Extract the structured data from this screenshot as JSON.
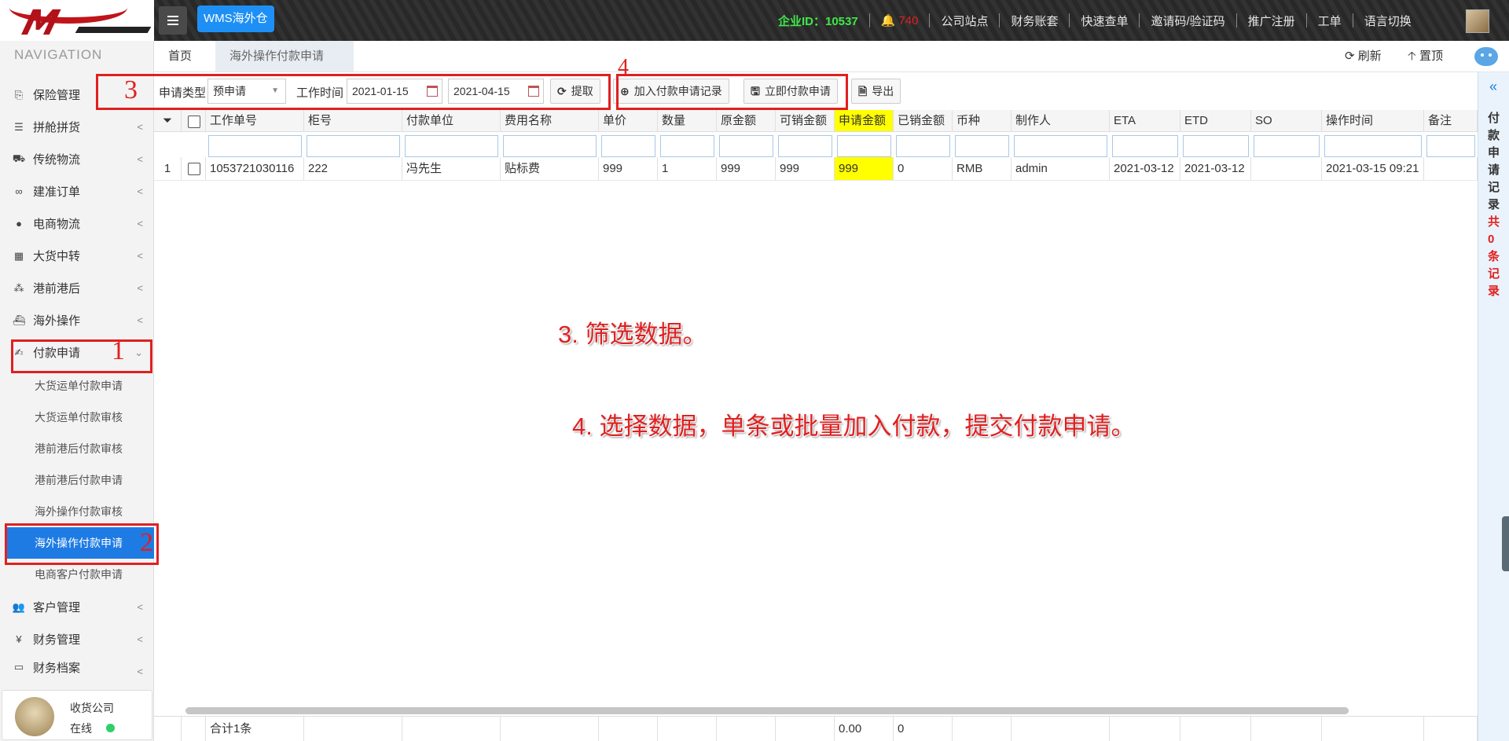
{
  "topbar": {
    "wms_badge": "WMS海外仓",
    "enterprise_id": "企业ID：10537",
    "notifications": "740",
    "links": [
      "公司站点",
      "财务账套",
      "快速查单",
      "邀请码/验证码",
      "推广注册",
      "工单",
      "语言切换"
    ]
  },
  "sidebar": {
    "title": "NAVIGATION",
    "items": [
      {
        "label": "保险管理",
        "icon": "shield-icon"
      },
      {
        "label": "拼舱拼货",
        "icon": "list-icon"
      },
      {
        "label": "传统物流",
        "icon": "truck-icon"
      },
      {
        "label": "建准订单",
        "icon": "link-icon"
      },
      {
        "label": "电商物流",
        "icon": "globe-icon"
      },
      {
        "label": "大货中转",
        "icon": "grid-icon"
      },
      {
        "label": "港前港后",
        "icon": "cubes-icon"
      },
      {
        "label": "海外操作",
        "icon": "ship-icon"
      },
      {
        "label": "付款申请",
        "icon": "payment-icon"
      }
    ],
    "subitems": [
      "大货运单付款申请",
      "大货运单付款审核",
      "港前港后付款审核",
      "港前港后付款申请",
      "海外操作付款审核",
      "海外操作付款申请",
      "电商客户付款申请"
    ],
    "bottom_items": [
      {
        "label": "客户管理",
        "icon": "users-icon"
      },
      {
        "label": "财务管理",
        "icon": "yen-icon"
      },
      {
        "label": "财务档案",
        "icon": "archive-icon"
      }
    ],
    "user": {
      "name": "收货公司",
      "status": "在线"
    }
  },
  "tabs": {
    "home": "首页",
    "current": "海外操作付款申请",
    "refresh": "刷新",
    "top": "置顶"
  },
  "filters": {
    "type_label": "申请类型",
    "type_value": "预申请",
    "time_label": "工作时间",
    "date_from": "2021-01-15",
    "date_to": "2021-04-15",
    "fetch_button": "提取",
    "add_record_button": "加入付款申请记录",
    "apply_now_button": "立即付款申请",
    "export_button": "导出"
  },
  "grid": {
    "columns": [
      "工作单号",
      "柜号",
      "付款单位",
      "费用名称",
      "单价",
      "数量",
      "原金额",
      "可销金额",
      "申请金额",
      "已销金额",
      "币种",
      "制作人",
      "ETA",
      "ETD",
      "SO",
      "操作时间",
      "备注"
    ],
    "rows": [
      {
        "index": "1",
        "cells": [
          "1053721030116",
          "222",
          "冯先生",
          "贴标费",
          "999",
          "1",
          "999",
          "999",
          "999",
          "0",
          "RMB",
          "admin",
          "2021-03-12",
          "2021-03-12",
          "",
          "2021-03-15 09:21",
          ""
        ]
      }
    ],
    "footer": {
      "total": "合计1条",
      "apply_sum": "0.00",
      "cleared_sum": "0"
    }
  },
  "right_panel": {
    "title": "付款申请记录",
    "count_text": "共0条记录"
  },
  "annotations": {
    "n1": "1",
    "n2": "2",
    "n3": "3",
    "n4": "4",
    "text3": "3. 筛选数据。",
    "text4": "4. 选择数据，单条或批量加入付款，提交付款申请。"
  }
}
